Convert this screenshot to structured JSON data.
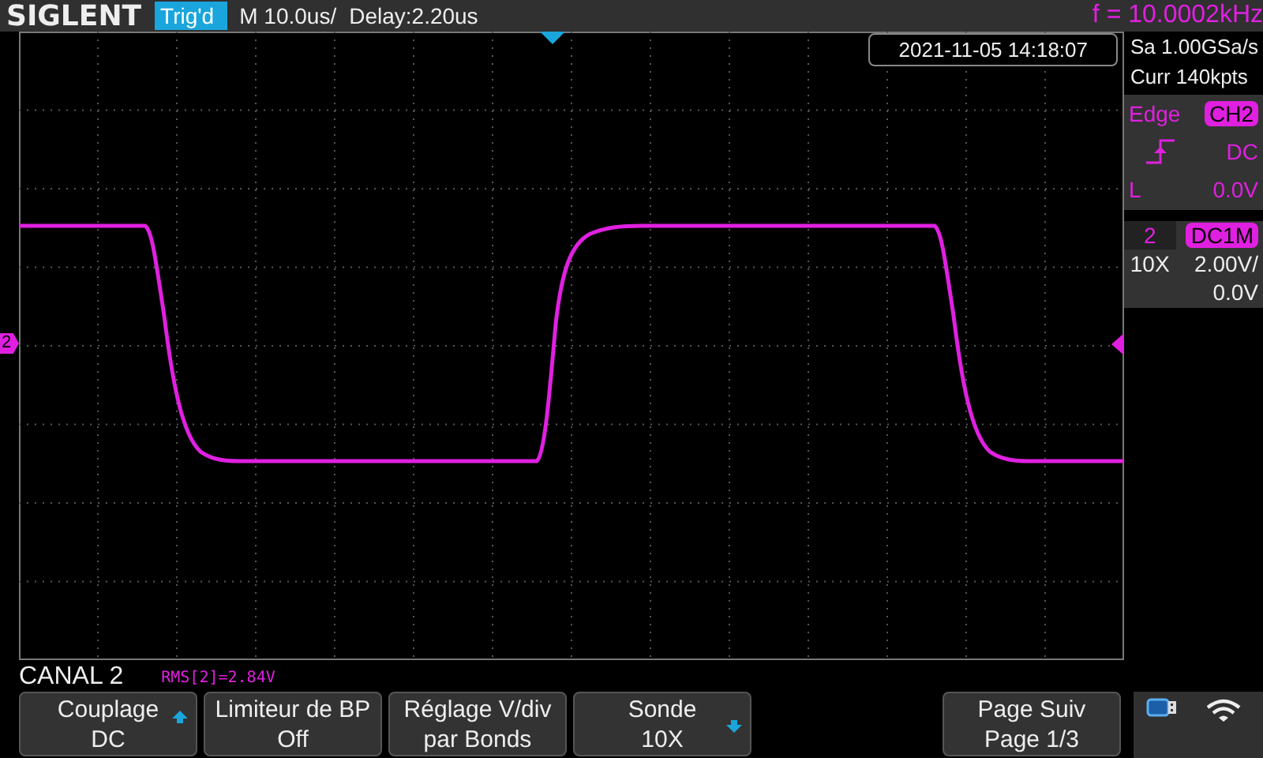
{
  "top_bar": {
    "logo": "SIGLENT",
    "trigger_status": "Trig'd",
    "timebase": "M 10.0us/",
    "delay": "Delay:2.20us",
    "frequency": "f = 10.0002kHz"
  },
  "timestamp": "2021-11-05 14:18:07",
  "acquisition": {
    "sample_rate": "Sa 1.00GSa/s",
    "memory_depth": "Curr 140kpts"
  },
  "trigger": {
    "type": "Edge",
    "source": "CH2",
    "coupling": "DC",
    "threshold_label": "L",
    "threshold": "0.0V"
  },
  "channel": {
    "number": "2",
    "coupling": "DC1M",
    "probe": "10X",
    "scale": "2.00V/",
    "offset": "0.0V"
  },
  "channel_marker": "2",
  "menu": {
    "title": "CANAL 2",
    "measurement": "RMS[2]=2.84V",
    "buttons": [
      {
        "label": "Couplage",
        "value": "DC",
        "kind": "scrollup"
      },
      {
        "label": "Limiteur de BP",
        "value": "Off",
        "kind": "plain"
      },
      {
        "label": "Réglage V/div",
        "value": "par Bonds",
        "kind": "plain"
      },
      {
        "label": "Sonde",
        "value": "10X",
        "kind": "scrolldown"
      }
    ],
    "page_button": {
      "label": "Page Suiv",
      "value": "Page 1/3"
    }
  }
}
